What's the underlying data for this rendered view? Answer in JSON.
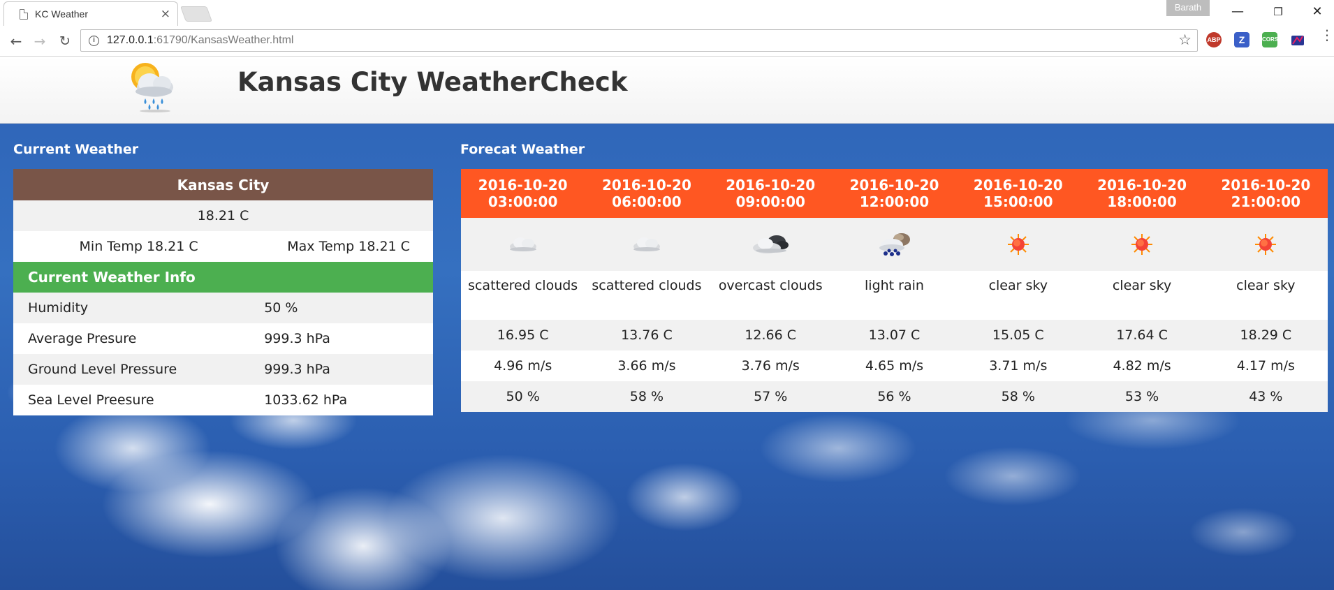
{
  "browser": {
    "tab_title": "KC Weather",
    "tab_close": "×",
    "profile_name": "Barath",
    "url_host": "127.0.0.1",
    "url_port_path": ":61790/KansasWeather.html",
    "extensions": [
      {
        "label": "ABP",
        "color": "#c0392b",
        "icon": "adblock-icon"
      },
      {
        "label": "Z",
        "color": "#3a5fc8",
        "icon": "zotero-icon"
      },
      {
        "label": "CORS",
        "color": "#4caf50",
        "icon": "cors-icon"
      },
      {
        "label": "",
        "color": "#1a237e",
        "icon": "extension-icon"
      }
    ]
  },
  "header": {
    "title": "Kansas City WeatherCheck",
    "logo_icon": "sun-cloud-rain-icon"
  },
  "current": {
    "heading": "Current Weather",
    "city": "Kansas City",
    "temp": "18.21 C",
    "min_temp": "Min Temp 18.21 C",
    "max_temp": "Max Temp 18.21 C",
    "info_heading": "Current Weather Info",
    "rows": [
      {
        "label": "Humidity",
        "value": "50 %"
      },
      {
        "label": "Average Presure",
        "value": "999.3 hPa"
      },
      {
        "label": "Ground Level Pressure",
        "value": "999.3 hPa"
      },
      {
        "label": "Sea Level Preesure",
        "value": "1033.62 hPa"
      }
    ]
  },
  "forecast": {
    "heading": "Forecat Weather",
    "columns": [
      {
        "date": "2016-10-20",
        "time": "03:00:00",
        "icon": "scattered-clouds-icon",
        "desc": "scattered clouds",
        "temp": "16.95 C",
        "wind": "4.96 m/s",
        "humidity": "50 %"
      },
      {
        "date": "2016-10-20",
        "time": "06:00:00",
        "icon": "scattered-clouds-icon",
        "desc": "scattered clouds",
        "temp": "13.76 C",
        "wind": "3.66 m/s",
        "humidity": "58 %"
      },
      {
        "date": "2016-10-20",
        "time": "09:00:00",
        "icon": "overcast-clouds-icon",
        "desc": "overcast clouds",
        "temp": "12.66 C",
        "wind": "3.76 m/s",
        "humidity": "57 %"
      },
      {
        "date": "2016-10-20",
        "time": "12:00:00",
        "icon": "light-rain-icon",
        "desc": "light rain",
        "temp": "13.07 C",
        "wind": "4.65 m/s",
        "humidity": "56 %"
      },
      {
        "date": "2016-10-20",
        "time": "15:00:00",
        "icon": "clear-sky-icon",
        "desc": "clear sky",
        "temp": "15.05 C",
        "wind": "3.71 m/s",
        "humidity": "58 %"
      },
      {
        "date": "2016-10-20",
        "time": "18:00:00",
        "icon": "clear-sky-icon",
        "desc": "clear sky",
        "temp": "17.64 C",
        "wind": "4.82 m/s",
        "humidity": "53 %"
      },
      {
        "date": "2016-10-20",
        "time": "21:00:00",
        "icon": "clear-sky-icon",
        "desc": "clear sky",
        "temp": "18.29 C",
        "wind": "4.17 m/s",
        "humidity": "43 %"
      }
    ]
  }
}
